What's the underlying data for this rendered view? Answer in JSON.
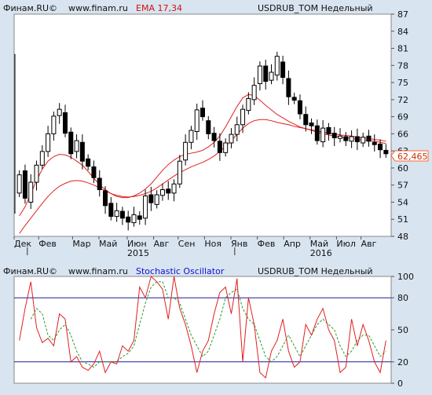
{
  "top_panel": {
    "header": {
      "source": "Финам.RU©",
      "site": "www.finam.ru",
      "indicator": "EMA 17,34",
      "instrument": "USDRUB_TOM Недельный"
    },
    "last_price_label": "62,465"
  },
  "bottom_panel": {
    "header": {
      "source": "Финам.RU©",
      "site": "www.finam.ru",
      "indicator": "Stochastic Oscillator",
      "instrument": "USDRUB_TOM Недельный"
    }
  },
  "colors": {
    "background": "#d8e4f0",
    "plot_background": "#ffffff",
    "candle_up": "#ffffff",
    "candle_down": "#000000",
    "ema": "#e02020",
    "stoch_k": "#e02020",
    "stoch_d": "#2a9a2a",
    "levels": "#1a1aa0",
    "indicator_top": "#d01010",
    "indicator_bottom": "#1010d0",
    "price_label": "#ff6633"
  },
  "chart_data": [
    {
      "type": "candlestick",
      "title": "USDRUB_TOM Недельный",
      "x_tick_labels": [
        "Дек",
        "Фев",
        "Мар",
        "Май",
        "Июн",
        "Авг",
        "Сен",
        "Ноя",
        "Янв",
        "Фев",
        "Апр",
        "Май",
        "Июл",
        "Авг"
      ],
      "year_labels": [
        "2015",
        "2016"
      ],
      "y_tick_labels": [
        "87",
        "84",
        "81",
        "78",
        "75",
        "72",
        "69",
        "66",
        "63",
        "60",
        "57",
        "54",
        "51",
        "48"
      ],
      "ylim": [
        48,
        87
      ],
      "last_price": 62.465,
      "series": [
        {
          "name": "EMA 17",
          "values": [
            51.6,
            53.2,
            55.5,
            57.8,
            59.8,
            61.2,
            62.0,
            62.4,
            62.3,
            61.9,
            61.2,
            60.5,
            59.4,
            58.2,
            57.1,
            56.2,
            55.5,
            55.0,
            54.8,
            54.8,
            55.1,
            55.6,
            56.3,
            57.2,
            58.4,
            59.6,
            60.6,
            61.4,
            62.0,
            62.4,
            62.6,
            62.8,
            63.1,
            63.7,
            64.5,
            65.6,
            67.2,
            69.0,
            70.8,
            72.3,
            72.9,
            72.7,
            71.9,
            71.0,
            70.2,
            69.4,
            68.8,
            68.2,
            67.7,
            67.2,
            66.9,
            66.6,
            66.3,
            66.0,
            65.8,
            65.6,
            65.4,
            65.3,
            65.2,
            65.0,
            64.9,
            64.8,
            64.7,
            64.5,
            64.3
          ]
        },
        {
          "name": "EMA 34",
          "values": [
            48.5,
            49.9,
            51.2,
            52.5,
            53.8,
            55.0,
            56.0,
            56.8,
            57.3,
            57.7,
            57.8,
            57.7,
            57.4,
            57.0,
            56.5,
            56.0,
            55.5,
            55.2,
            55.0,
            54.9,
            55.0,
            55.2,
            55.5,
            55.9,
            56.5,
            57.2,
            57.9,
            58.6,
            59.2,
            59.7,
            60.2,
            60.6,
            61.0,
            61.5,
            62.1,
            62.9,
            63.8,
            64.8,
            65.9,
            67.0,
            67.8,
            68.3,
            68.5,
            68.5,
            68.3,
            68.0,
            67.8,
            67.6,
            67.3,
            67.1,
            66.9,
            66.7,
            66.5,
            66.3,
            66.1,
            66.0,
            65.8,
            65.7,
            65.6,
            65.4,
            65.3,
            65.2,
            65.0,
            64.9,
            64.7
          ]
        },
        {
          "name": "OHLC",
          "open_close": [
            [
              55.6,
              58.8
            ],
            [
              59.5,
              54.7
            ],
            [
              54.0,
              57.5
            ],
            [
              57.5,
              60.5
            ],
            [
              60.5,
              62.9
            ],
            [
              62.9,
              66.0
            ],
            [
              66.0,
              69.1
            ],
            [
              69.2,
              70.3
            ],
            [
              69.7,
              66.1
            ],
            [
              66.3,
              62.5
            ],
            [
              62.9,
              64.8
            ],
            [
              64.5,
              61.2
            ],
            [
              61.6,
              60.3
            ],
            [
              60.2,
              58.3
            ],
            [
              58.2,
              56.2
            ],
            [
              56.0,
              53.4
            ],
            [
              53.8,
              51.5
            ],
            [
              51.5,
              52.5
            ],
            [
              52.4,
              51.2
            ],
            [
              51.4,
              50.5
            ],
            [
              50.4,
              51.8
            ],
            [
              51.6,
              51.0
            ],
            [
              51.2,
              55.1
            ],
            [
              55.3,
              53.9
            ],
            [
              53.6,
              55.3
            ],
            [
              55.2,
              56.2
            ],
            [
              56.3,
              55.6
            ],
            [
              55.6,
              57.2
            ],
            [
              57.2,
              61.2
            ],
            [
              61.4,
              64.5
            ],
            [
              64.5,
              66.6
            ],
            [
              66.4,
              70.2
            ],
            [
              70.5,
              69.0
            ],
            [
              68.3,
              66.0
            ],
            [
              66.1,
              64.8
            ],
            [
              64.7,
              62.7
            ],
            [
              62.7,
              64.4
            ],
            [
              64.4,
              65.9
            ],
            [
              65.9,
              67.6
            ],
            [
              67.6,
              70.3
            ],
            [
              70.1,
              72.2
            ],
            [
              72.0,
              74.5
            ],
            [
              74.8,
              77.9
            ],
            [
              77.9,
              75.2
            ],
            [
              75.4,
              76.8
            ],
            [
              76.3,
              79.6
            ],
            [
              78.6,
              75.9
            ],
            [
              75.7,
              72.5
            ],
            [
              72.4,
              71.9
            ],
            [
              71.8,
              69.5
            ],
            [
              69.4,
              67.6
            ],
            [
              67.9,
              67.4
            ],
            [
              67.4,
              64.8
            ],
            [
              64.6,
              67.0
            ],
            [
              67.1,
              66.0
            ],
            [
              66.1,
              65.3
            ],
            [
              65.2,
              65.6
            ],
            [
              65.5,
              64.8
            ],
            [
              64.7,
              65.5
            ],
            [
              65.5,
              64.6
            ],
            [
              64.4,
              65.4
            ],
            [
              65.6,
              64.7
            ],
            [
              64.5,
              64.1
            ],
            [
              64.2,
              63.2
            ],
            [
              63.1,
              62.5
            ]
          ]
        }
      ]
    },
    {
      "type": "line",
      "title": "Stochastic Oscillator",
      "y_tick_labels": [
        "100",
        "80",
        "50",
        "20",
        "0"
      ],
      "ylim": [
        0,
        100
      ],
      "levels": [
        80,
        20
      ],
      "series": [
        {
          "name": "%K",
          "values": [
            40,
            70,
            95,
            52,
            38,
            42,
            35,
            65,
            60,
            20,
            25,
            15,
            12,
            18,
            30,
            10,
            20,
            18,
            35,
            30,
            40,
            90,
            80,
            100,
            95,
            88,
            60,
            100,
            70,
            55,
            35,
            10,
            30,
            40,
            65,
            85,
            90,
            65,
            98,
            20,
            80,
            55,
            10,
            5,
            30,
            40,
            60,
            30,
            15,
            20,
            55,
            45,
            60,
            70,
            50,
            40,
            10,
            15,
            60,
            35,
            55,
            40,
            20,
            10,
            40
          ]
        },
        {
          "name": "%D",
          "values": [
            null,
            null,
            60,
            70,
            65,
            45,
            40,
            50,
            55,
            45,
            30,
            20,
            18,
            15,
            20,
            20,
            20,
            20,
            25,
            28,
            35,
            55,
            75,
            90,
            95,
            95,
            80,
            80,
            75,
            60,
            45,
            35,
            25,
            30,
            45,
            60,
            80,
            85,
            88,
            70,
            60,
            55,
            40,
            25,
            20,
            25,
            35,
            45,
            35,
            25,
            35,
            45,
            55,
            60,
            55,
            50,
            35,
            25,
            30,
            40,
            45,
            45,
            35,
            25,
            30
          ]
        }
      ]
    }
  ]
}
